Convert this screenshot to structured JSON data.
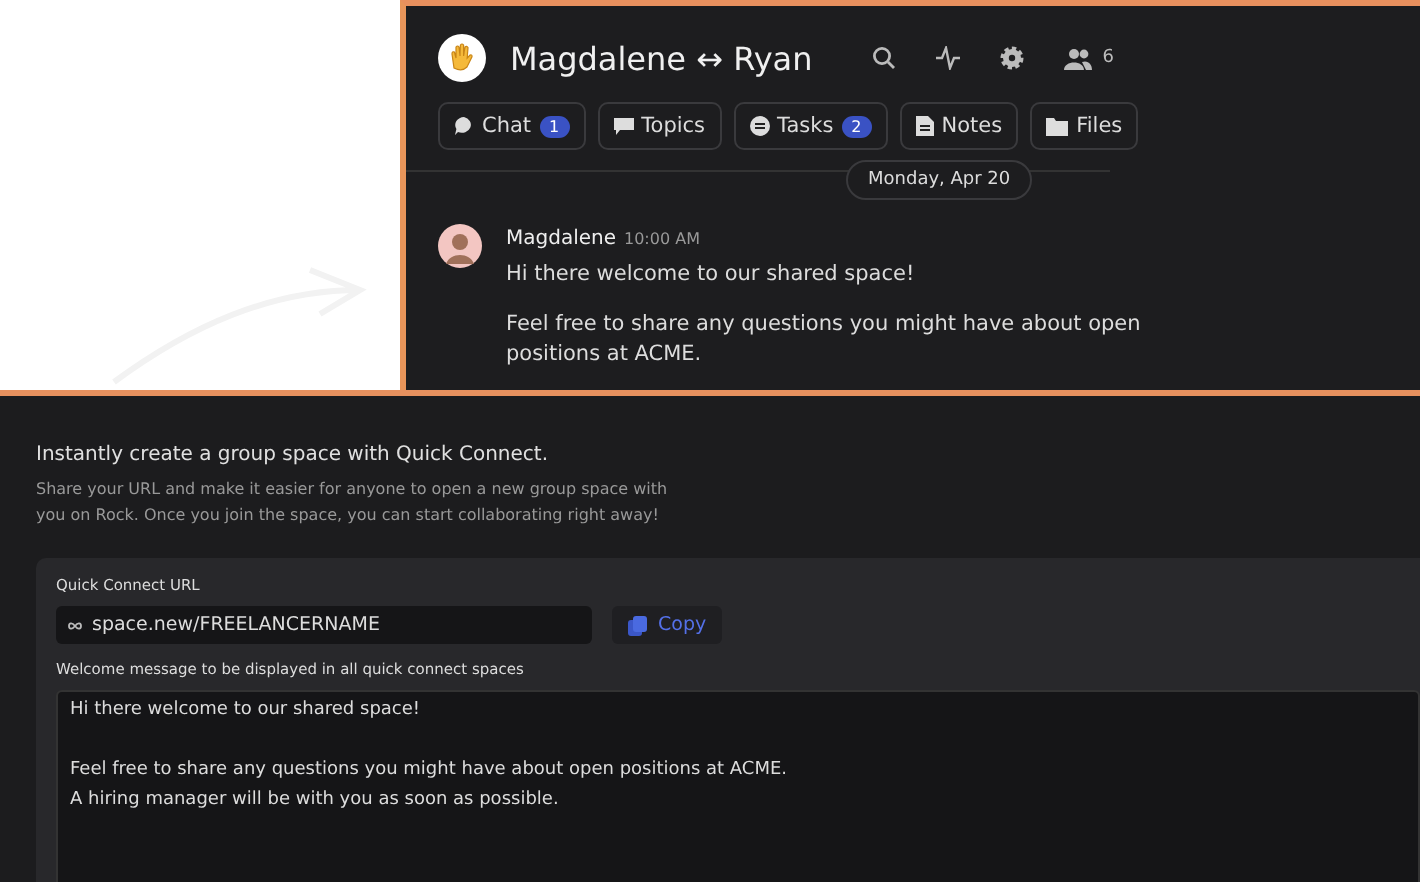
{
  "preview": {
    "title": "Magdalene ↔ Ryan",
    "member_count": "6",
    "tabs": [
      {
        "label": "Chat",
        "badge": "1"
      },
      {
        "label": "Topics"
      },
      {
        "label": "Tasks",
        "badge": "2"
      },
      {
        "label": "Notes"
      },
      {
        "label": "Files"
      }
    ],
    "date": "Monday, Apr 20",
    "message": {
      "author": "Magdalene",
      "time": "10:00 AM",
      "paragraphs": [
        "Hi there welcome to our shared space!",
        "Feel free to share any questions you might have about open positions at ACME."
      ]
    }
  },
  "quick_connect": {
    "heading": "Instantly create a group space with Quick Connect.",
    "description": "Share your URL and make it easier for anyone to open a new group space with you on Rock. Once you join the space, you can start collaborating right away!",
    "url_label": "Quick Connect URL",
    "url": "space.new/FREELANCERNAME",
    "copy_label": "Copy",
    "welcome_label": "Welcome message to be displayed in all quick connect spaces",
    "welcome_paragraphs": [
      [
        "Hi there welcome to our shared space!"
      ],
      [
        "Feel free to share any questions you might have about open positions at ACME.",
        "A hiring manager will be with you as soon as possible."
      ]
    ]
  }
}
